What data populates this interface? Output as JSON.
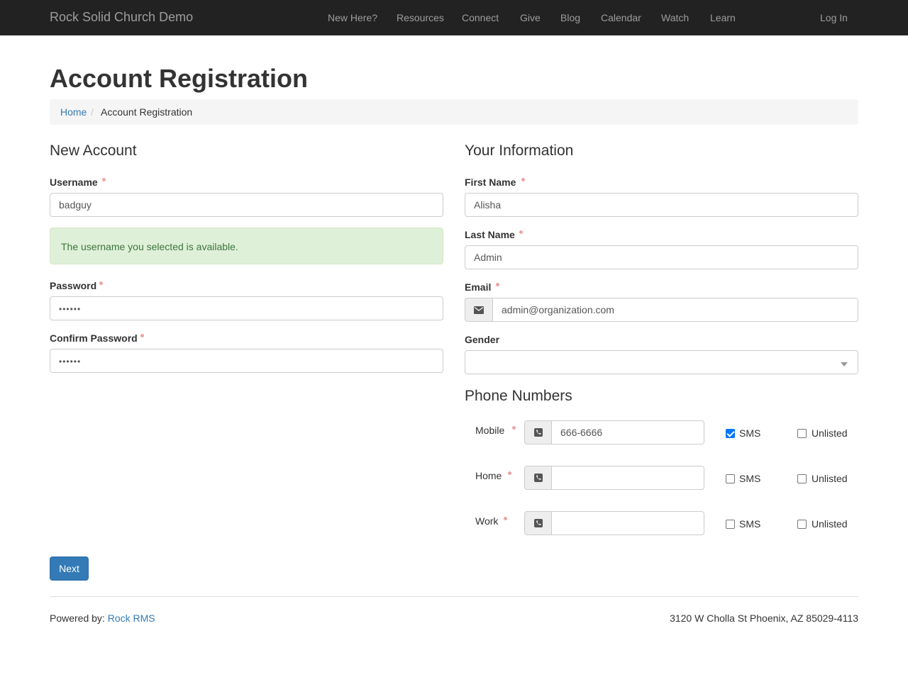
{
  "header": {
    "brand": "Rock Solid Church Demo",
    "nav": [
      "New Here?",
      "Resources",
      "Connect",
      "Give",
      "Blog",
      "Calendar",
      "Watch",
      "Learn"
    ],
    "login": "Log In"
  },
  "page": {
    "title": "Account Registration",
    "breadcrumb": {
      "home": "Home",
      "separator": "/",
      "current": "Account Registration"
    }
  },
  "new_account": {
    "title": "New Account",
    "username_label": "Username",
    "username_value": "badguy",
    "availability_message": "The username you selected is available.",
    "password_label": "Password",
    "password_value": "••••••",
    "confirm_password_label": "Confirm Password",
    "confirm_password_value": "••••••"
  },
  "your_information": {
    "title": "Your Information",
    "first_name_label": "First Name",
    "first_name_value": "Alisha",
    "last_name_label": "Last Name",
    "last_name_value": "Admin",
    "email_label": "Email",
    "email_value": "admin@organization.com",
    "gender_label": "Gender",
    "gender_value": ""
  },
  "phone_numbers": {
    "title": "Phone Numbers",
    "sms_label": "SMS",
    "unlisted_label": "Unlisted",
    "rows": [
      {
        "label": "Mobile",
        "value": "666-6666",
        "sms": true,
        "unlisted": false
      },
      {
        "label": "Home",
        "value": "",
        "sms": false,
        "unlisted": false
      },
      {
        "label": "Work",
        "value": "",
        "sms": false,
        "unlisted": false
      }
    ]
  },
  "actions": {
    "next_label": "Next"
  },
  "footer": {
    "powered_by": "Powered by: ",
    "powered_link": "Rock RMS",
    "address": "3120 W Cholla St Phoenix, AZ 85029-4113"
  },
  "colors": {
    "navbar": "#222222",
    "link": "#337ab7",
    "success_bg": "#dff0d8",
    "success_text": "#3c763d",
    "required_dot": "#eba5a3"
  }
}
